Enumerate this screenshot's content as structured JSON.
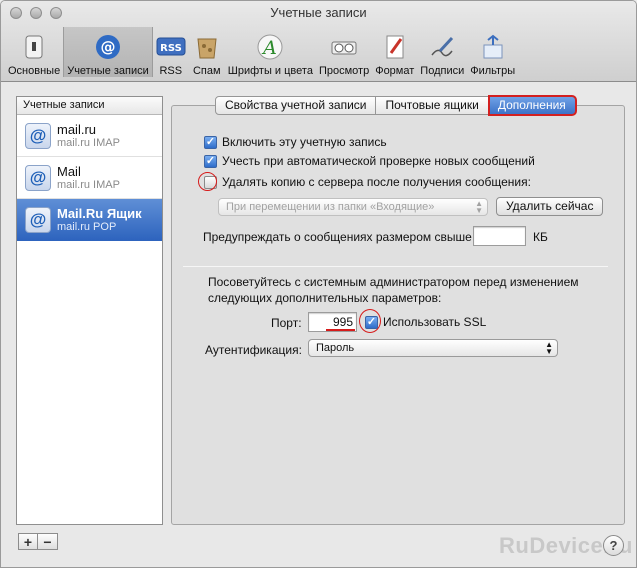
{
  "window": {
    "title": "Учетные записи"
  },
  "toolbar": {
    "items": [
      {
        "label": "Основные",
        "icon": "switch-icon"
      },
      {
        "label": "Учетные записи",
        "icon": "at-sign-icon",
        "active": true
      },
      {
        "label": "RSS",
        "icon": "rss-icon"
      },
      {
        "label": "Спам",
        "icon": "junk-mail-icon"
      },
      {
        "label": "Шрифты и цвета",
        "icon": "fonts-colors-icon"
      },
      {
        "label": "Просмотр",
        "icon": "viewing-icon"
      },
      {
        "label": "Формат",
        "icon": "composing-icon"
      },
      {
        "label": "Подписи",
        "icon": "signatures-icon"
      },
      {
        "label": "Фильтры",
        "icon": "rules-icon"
      }
    ]
  },
  "sidebar": {
    "header": "Учетные записи",
    "accounts": [
      {
        "name": "mail.ru",
        "type": "mail.ru IMAP"
      },
      {
        "name": "Mail",
        "type": "mail.ru IMAP"
      },
      {
        "name": "Mail.Ru Ящик",
        "type": "mail.ru POP",
        "selected": true
      }
    ],
    "add_label": "+",
    "remove_label": "−"
  },
  "tabs": [
    {
      "label": "Свойства учетной записи"
    },
    {
      "label": "Почтовые ящики"
    },
    {
      "label": "Дополнения",
      "selected": true
    }
  ],
  "advanced": {
    "enable_account": {
      "label": "Включить эту учетную запись",
      "checked": true
    },
    "include_check": {
      "label": "Учесть при автоматической проверке новых сообщений",
      "checked": true
    },
    "remove_copy": {
      "label": "Удалять копию с сервера после получения сообщения:",
      "checked": false
    },
    "remove_when": {
      "value": "При перемещении из папки «Входящие»"
    },
    "remove_now": "Удалить сейчас",
    "warn_size_label": "Предупреждать о сообщениях размером свыше",
    "warn_size_value": "",
    "warn_size_unit": "КБ",
    "note": "Посоветуйтесь с системным администратором перед изменением следующих дополнительных параметров:",
    "port_label": "Порт:",
    "port_value": "995",
    "use_ssl": {
      "label": "Использовать SSL",
      "checked": true
    },
    "auth_label": "Аутентификация:",
    "auth_value": "Пароль"
  },
  "help_label": "?",
  "watermark": "RuDevice.ru",
  "colors": {
    "selection": "#3d72c7",
    "annotation": "#d61b1b"
  }
}
